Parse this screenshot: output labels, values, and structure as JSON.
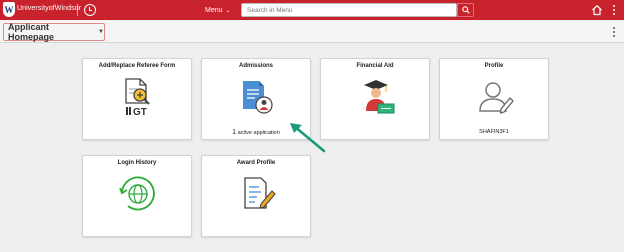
{
  "banner": {
    "logo_text": "UniversityofWindsor",
    "logo_mark": "W",
    "menu_label": "Menu",
    "search_placeholder": "Search in Menu",
    "icons": [
      "history-icon",
      "search-icon",
      "home-icon",
      "more-vertical-icon"
    ],
    "color": "#c8232c"
  },
  "page": {
    "title": "Applicant Homepage",
    "title_border_color": "#e08a8a"
  },
  "tiles": [
    {
      "title": "Add/Replace Referee Form",
      "icon": "document-magnify-gt-icon"
    },
    {
      "title": "Admissions",
      "icon": "application-user-icon",
      "footer_count": "1",
      "footer_text": "active application"
    },
    {
      "title": "Financial Aid",
      "icon": "graduate-money-icon"
    },
    {
      "title": "Profile",
      "icon": "user-edit-icon",
      "footer_text": "SHAFIN3F1"
    },
    {
      "title": "Login History",
      "icon": "globe-refresh-icon"
    },
    {
      "title": "Award Profile",
      "icon": "document-pencil-icon"
    }
  ],
  "annotation": {
    "arrow_color": "#1a9b7e"
  }
}
